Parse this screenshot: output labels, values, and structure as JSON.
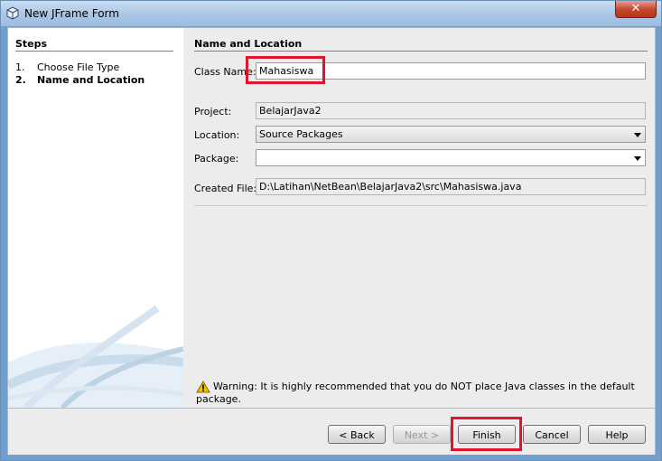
{
  "window": {
    "title": "New JFrame Form",
    "close_label": "✕"
  },
  "steps": {
    "heading": "Steps",
    "items": [
      {
        "num": "1.",
        "label": "Choose File Type"
      },
      {
        "num": "2.",
        "label": "Name and Location"
      }
    ]
  },
  "form": {
    "heading": "Name and Location",
    "class_name": {
      "label": "Class Name:",
      "value": "Mahasiswa"
    },
    "project": {
      "label": "Project:",
      "value": "BelajarJava2"
    },
    "location": {
      "label": "Location:",
      "value": "Source Packages"
    },
    "package": {
      "label": "Package:",
      "value": ""
    },
    "created_file": {
      "label": "Created File:",
      "value": "D:\\Latihan\\NetBean\\BelajarJava2\\src\\Mahasiswa.java"
    }
  },
  "warning": {
    "text": "Warning: It is highly recommended that you do NOT place Java classes in the default package."
  },
  "buttons": {
    "back": "< Back",
    "next": "Next >",
    "finish": "Finish",
    "cancel": "Cancel",
    "help": "Help"
  },
  "colors": {
    "highlight": "#e0142c",
    "titlebar": "#a9c6e6"
  },
  "icons": {
    "app": "app-cube-icon",
    "warning": "warning-triangle-icon",
    "combo": "chevron-down-icon"
  }
}
